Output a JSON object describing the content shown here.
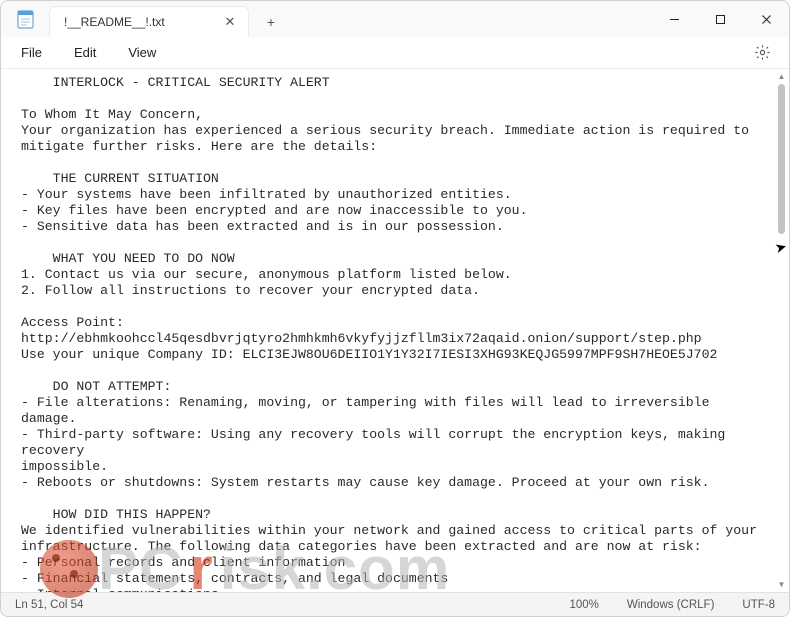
{
  "window": {
    "tab_title": "!__README__!.txt"
  },
  "menu": {
    "file": "File",
    "edit": "Edit",
    "view": "View"
  },
  "document": {
    "text": "    INTERLOCK - CRITICAL SECURITY ALERT\n\nTo Whom It May Concern,\nYour organization has experienced a serious security breach. Immediate action is required to\nmitigate further risks. Here are the details:\n\n    THE CURRENT SITUATION\n- Your systems have been infiltrated by unauthorized entities.\n- Key files have been encrypted and are now inaccessible to you.\n- Sensitive data has been extracted and is in our possession.\n\n    WHAT YOU NEED TO DO NOW\n1. Contact us via our secure, anonymous platform listed below.\n2. Follow all instructions to recover your encrypted data.\n\nAccess Point: http://ebhmkoohccl45qesdbvrjqtyro2hmhkmh6vkyfyjjzfllm3ix72aqaid.onion/support/step.php\nUse your unique Company ID: ELCI3EJW8OU6DEIIO1Y1Y32I7IESI3XHG93KEQJG5997MPF9SH7HEOE5J702\n\n    DO NOT ATTEMPT:\n- File alterations: Renaming, moving, or tampering with files will lead to irreversible damage.\n- Third-party software: Using any recovery tools will corrupt the encryption keys, making recovery\nimpossible.\n- Reboots or shutdowns: System restarts may cause key damage. Proceed at your own risk.\n\n    HOW DID THIS HAPPEN?\nWe identified vulnerabilities within your network and gained access to critical parts of your\ninfrastructure. The following data categories have been extracted and are now at risk:\n- Personal records and client information\n- Financial statements, contracts, and legal documents\n- Internal communications\n- Backups and business-critical files"
  },
  "status": {
    "position": "Ln 51, Col 54",
    "zoom": "100%",
    "line_endings": "Windows (CRLF)",
    "encoding": "UTF-8"
  },
  "watermark": {
    "text_left": "PC",
    "text_r": "r",
    "text_right": "isk.com"
  },
  "icons": {
    "close": "✕",
    "plus": "+"
  }
}
